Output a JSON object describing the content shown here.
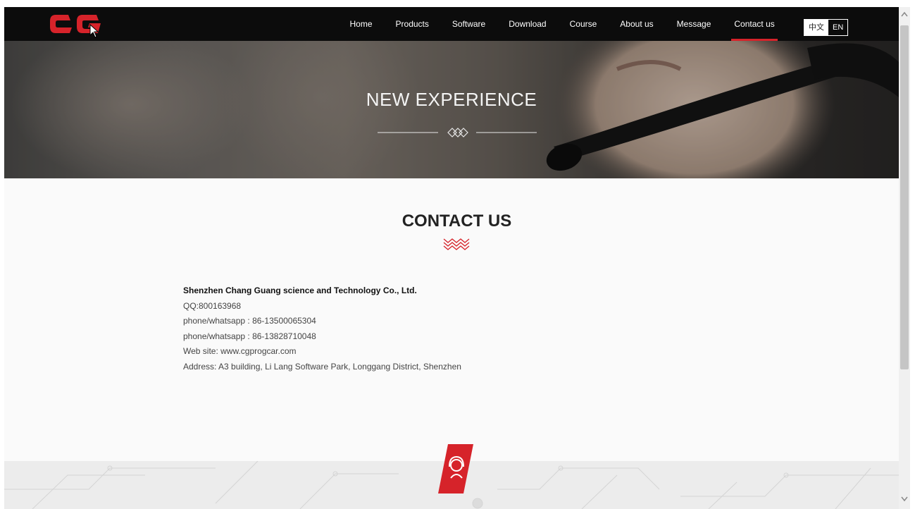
{
  "nav": {
    "logo_alt": "CG",
    "items": [
      "Home",
      "Products",
      "Software",
      "Download",
      "Course",
      "About us",
      "Message",
      "Contact us"
    ],
    "active_index": 7,
    "lang": {
      "zh": "中文",
      "en": "EN"
    }
  },
  "hero": {
    "title": "NEW EXPERIENCE"
  },
  "contact": {
    "title": "CONTACT US",
    "company": "Shenzhen Chang Guang science and Technology Co., Ltd.",
    "qq": "QQ:800163968",
    "phone1": "phone/whatsapp : 86-13500065304",
    "phone2": "phone/whatsapp : 86-13828710048",
    "website": "Web site: www.cgprogcar.com",
    "address": "Address: A3 building, Li Lang Software Park, Longgang District, Shenzhen"
  },
  "colors": {
    "accent": "#d6232a",
    "nav_bg": "#0c0c0c",
    "page_bg": "#fafafa"
  }
}
